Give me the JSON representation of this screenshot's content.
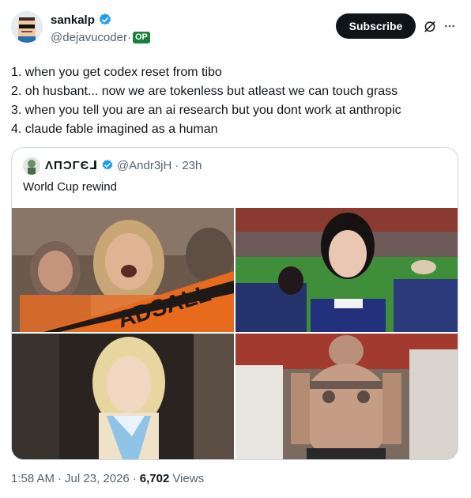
{
  "author": {
    "display_name": "sankalp",
    "handle": "@dejavucoder",
    "handle_sep": "·",
    "op_badge": "OP",
    "verified_color": "#1d9bf0",
    "avatar_icon": "pixel-avatar-sunglasses"
  },
  "actions": {
    "subscribe_label": "Subscribe",
    "grok_icon": "grok-icon",
    "more_icon": "more-icon"
  },
  "tweet": {
    "lines": [
      "1. when you get codex reset from tibo",
      "2. oh husbant... now we are tokenless but atleast we can touch grass",
      "3. when you tell you are an ai research but you dont work at anthropic",
      "4. claude fable imagined as a human"
    ]
  },
  "quote": {
    "display_name": "ΛΠϽΓЄ⅃",
    "handle": "@Andr3jH",
    "time_sep": "·",
    "time": "23h",
    "text": "World Cup rewind",
    "media": [
      {
        "name": "cheering-fan-orange-banner",
        "banner_text": "ADSALL"
      },
      {
        "name": "fan-stadium-blue-jersey"
      },
      {
        "name": "blonde-woman-scarf"
      },
      {
        "name": "shirtless-tattooed-fan"
      }
    ]
  },
  "meta": {
    "time": "1:58 AM",
    "sep1": "·",
    "date": "Jul 23, 2026",
    "sep2": "·",
    "views_count": "6,702",
    "views_label": "Views"
  }
}
